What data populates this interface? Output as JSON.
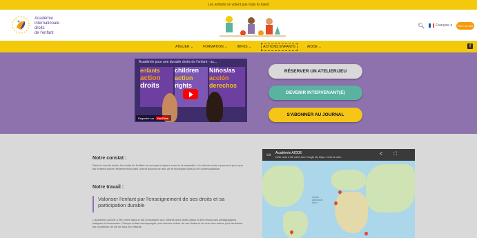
{
  "topbar": {
    "text": "Les enfants ne votent pas mais ils lisent"
  },
  "header": {
    "brand_lines": [
      "Académie",
      "internationale",
      "droits",
      "de l'enfant"
    ],
    "language": "Français",
    "donate_label": "Faire un don"
  },
  "nav": {
    "items": [
      {
        "label": "ATELIER ⌄"
      },
      {
        "label": "FORMATION ⌄"
      },
      {
        "label": "INFOS ⌄"
      },
      {
        "label": "ACTIONS ENFANTS"
      },
      {
        "label": "AIDDE ⌄"
      }
    ]
  },
  "hero": {
    "video": {
      "title": "Académie pour une durable droits de l'enfant - ac...",
      "poster_lines": [
        "enfants",
        "action",
        "droits",
        "children",
        "action",
        "rights",
        "Niños/as",
        "acción",
        "derechos"
      ],
      "watch_label": "Regarder sur",
      "youtube_label": "YouTube"
    },
    "buttons": {
      "booking": "RÉSERVER UN ATELIER/JEU",
      "speaker": "DEVENIR INTERVENANT(E)",
      "journal": "S'ABONNER AU JOURNAL"
    }
  },
  "content": {
    "constat_title": "Notre constat :",
    "constat_text": "Dans le monde entier, les droits de l'enfant ne sont pas toujours connus et respectés. Un chemin reste à parcourir pour que les enfants soient réellement écoutés, soient acteurs de leur vie et impliqués dans la vie communautaire.",
    "travail_title": "Notre travail :",
    "quote": "Valoriser l'enfant par l'enseignement de ses droits et sa participation durable",
    "aidde_text": "L'académie AIDDE a été créée dans le but d'enseigner aux enfants leurs droits grâce à des ressources pédagogiques ludiques et innovantes. Chaque enfant accompagné peut devenir acteur de ses droits et de ceux des autres pour améliorer les conditions de vie de tous les enfants."
  },
  "map": {
    "title": "Académie AIDDE",
    "subtitle": "Cette carte a été créée avec Google My Maps. Créez la vôtre.",
    "sea_labels": [
      "Océan",
      "Atlantique",
      "Nord"
    ]
  },
  "colors": {
    "yellow": "#f3c90c",
    "purple": "#8d72ad",
    "teal": "#5ab3a1",
    "gold": "#f5c518"
  }
}
